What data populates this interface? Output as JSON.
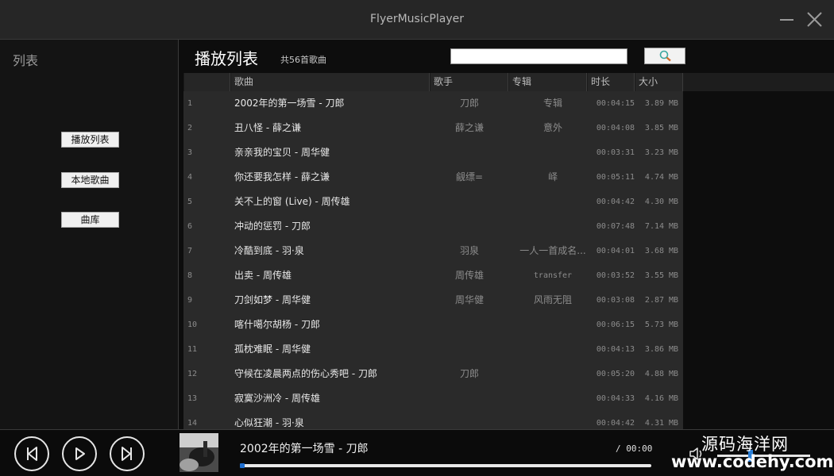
{
  "app": {
    "title": "FlyerMusicPlayer"
  },
  "sidebar": {
    "title": "列表",
    "buttons": [
      "播放列表",
      "本地歌曲",
      "曲库"
    ]
  },
  "main": {
    "heading": "播放列表",
    "count": "共56首歌曲",
    "search": {
      "value": "",
      "placeholder": ""
    },
    "columns": [
      "歌曲",
      "歌手",
      "专辑",
      "时长",
      "大小"
    ],
    "rows": [
      {
        "index": "1",
        "song": "2002年的第一场雪 - 刀郎",
        "artist": "刀郎",
        "album": "专辑",
        "duration": "00:04:15",
        "size": "3.89 MB"
      },
      {
        "index": "2",
        "song": "丑八怪 - 薛之谦",
        "artist": "薛之谦",
        "album": "意外",
        "duration": "00:04:08",
        "size": "3.85 MB"
      },
      {
        "index": "3",
        "song": "亲亲我的宝贝 - 周华健",
        "artist": "",
        "album": "",
        "duration": "00:03:31",
        "size": "3.23 MB"
      },
      {
        "index": "4",
        "song": "你还要我怎样 - 薛之谦",
        "artist": "觎缥=",
        "album": "峄",
        "duration": "00:05:11",
        "size": "4.74 MB"
      },
      {
        "index": "5",
        "song": "关不上的窗 (Live) - 周传雄",
        "artist": "",
        "album": "",
        "duration": "00:04:42",
        "size": "4.30 MB"
      },
      {
        "index": "6",
        "song": "冲动的惩罚 - 刀郎",
        "artist": "",
        "album": "",
        "duration": "00:07:48",
        "size": "7.14 MB"
      },
      {
        "index": "7",
        "song": "冷酷到底 - 羽·泉",
        "artist": "羽泉",
        "album": "一人一首成名...",
        "duration": "00:04:01",
        "size": "3.68 MB"
      },
      {
        "index": "8",
        "song": "出卖 - 周传雄",
        "artist": "周传雄",
        "album": "transfer",
        "duration": "00:03:52",
        "size": "3.55 MB"
      },
      {
        "index": "9",
        "song": "刀剑如梦 - 周华健",
        "artist": "周华健",
        "album": "风雨无阻",
        "duration": "00:03:08",
        "size": "2.87 MB"
      },
      {
        "index": "10",
        "song": "喀什噶尔胡杨 - 刀郎",
        "artist": "",
        "album": "",
        "duration": "00:06:15",
        "size": "5.73 MB"
      },
      {
        "index": "11",
        "song": "孤枕难眠 - 周华健",
        "artist": "",
        "album": "",
        "duration": "00:04:13",
        "size": "3.86 MB"
      },
      {
        "index": "12",
        "song": "守候在凌晨两点的伤心秀吧 - 刀郎",
        "artist": "刀郎",
        "album": "",
        "duration": "00:05:20",
        "size": "4.88 MB"
      },
      {
        "index": "13",
        "song": "寂寞沙洲冷 - 周传雄",
        "artist": "",
        "album": "",
        "duration": "00:04:33",
        "size": "4.16 MB"
      },
      {
        "index": "14",
        "song": "心似狂潮 - 羽·泉",
        "artist": "",
        "album": "",
        "duration": "00:04:42",
        "size": "4.31 MB"
      }
    ]
  },
  "player": {
    "now_playing": "2002年的第一场雪 - 刀郎",
    "time": "/ 00:00",
    "progress": 0,
    "volume": 0.35,
    "controls": [
      "previous-icon",
      "play-icon",
      "next-icon"
    ],
    "accent": "#2a7fd8"
  },
  "watermark": {
    "line1": "源码海洋网",
    "line2": "www.codehy.com"
  }
}
